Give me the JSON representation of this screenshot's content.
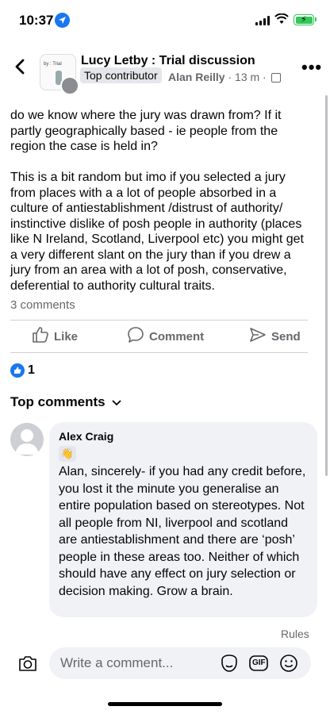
{
  "status_bar": {
    "time": "10:37"
  },
  "header": {
    "group_name": "Lucy Letby : Trial discussion",
    "badge": "Top contributor",
    "author": "Alan Reilly",
    "meta": " · 13 m · ",
    "avatar_text": "by : Trial"
  },
  "post": {
    "paragraphs": [
      "do we know where the jury was drawn from? If it partly geographically based - ie people from the region the case is held in?",
      "This is a bit random but imo  if you selected a jury from places with a a lot of people absorbed in a culture of antiestablishment /distrust of authority/ instinctive dislike of posh people in authority (places like N Ireland, Scotland, Liverpool etc) you might get a very different slant on the jury than if you drew a jury from an area with a lot of posh, conservative, deferential to authority cultural traits."
    ],
    "comments_count": "3 comments"
  },
  "actions": {
    "like": "Like",
    "comment": "Comment",
    "send": "Send"
  },
  "reactions": {
    "count": "1"
  },
  "top_comments_label": "Top comments",
  "comment": {
    "author": "Alex Craig",
    "text": "Alan, sincerely- if you had any credit before, you lost it the minute you generalise an entire population based on stereotypes. Not all people from NI, liverpool and scotland are antiestablishment and there are ‘posh’ people in these areas too. Neither of which should have any effect on jury selection or decision making. Grow a brain."
  },
  "rules": "Rules",
  "composer": {
    "placeholder": "Write a comment...",
    "gif_label": "GIF"
  },
  "colors": {
    "accent": "#1877f2",
    "battery": "#34c759",
    "secondary_text": "#65676b",
    "bubble": "#f0f2f5"
  }
}
